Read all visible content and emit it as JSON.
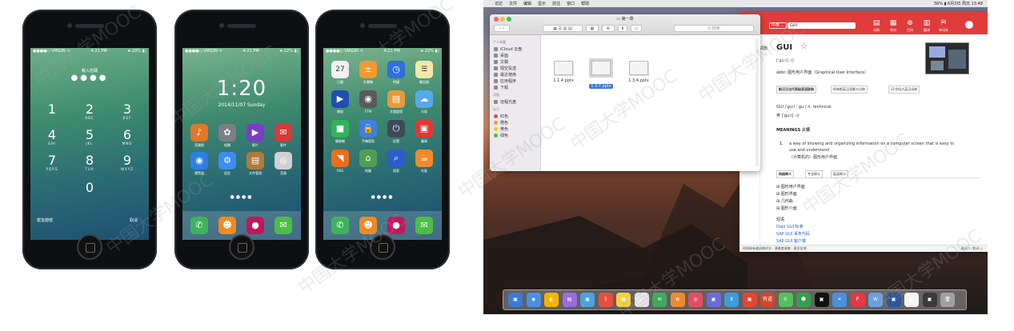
{
  "phones": [
    {
      "status": {
        "carrier": "●●●●○ VIRGIN ᯤ",
        "time": "4:21 PM",
        "battery": "⎈ 20% ▮▯"
      },
      "title": "輸入密碼",
      "keys": [
        {
          "n": "1",
          "l": ""
        },
        {
          "n": "2",
          "l": "ABC"
        },
        {
          "n": "3",
          "l": "DEF"
        },
        {
          "n": "4",
          "l": "GHI"
        },
        {
          "n": "5",
          "l": "JKL"
        },
        {
          "n": "6",
          "l": "MNO"
        },
        {
          "n": "7",
          "l": "PQRS"
        },
        {
          "n": "8",
          "l": "TUV"
        },
        {
          "n": "9",
          "l": "WXYZ"
        },
        {
          "n": "0",
          "l": ""
        }
      ],
      "bottom_left": "緊急撥號",
      "bottom_right": "取消"
    },
    {
      "status": {
        "carrier": "●●●●○ VIRGIN ᯤ",
        "time": "4:21 PM",
        "battery": "⎈ 22% ▮▯"
      },
      "clock": "1:20",
      "date": "2014/11/07 Sunday",
      "apps": [
        {
          "label": "音樂館",
          "color": "#e2762b",
          "glyph": "♪"
        },
        {
          "label": "相簿",
          "color": "#7b7f86",
          "glyph": "✿"
        },
        {
          "label": "影片",
          "color": "#7a3cc4",
          "glyph": "▶"
        },
        {
          "label": "郵件",
          "color": "#d8393a",
          "glyph": "✉"
        },
        {
          "label": "瀏覽器",
          "color": "#2d7fe6",
          "glyph": "◉"
        },
        {
          "label": "設定",
          "color": "#3d8cf0",
          "glyph": "⚙"
        },
        {
          "label": "文件管理",
          "color": "#b07a3a",
          "glyph": "▤"
        },
        {
          "label": "音樂",
          "color": "#d0d0d0",
          "glyph": "◎"
        }
      ],
      "dock": [
        {
          "color": "#3fb35a",
          "glyph": "✆"
        },
        {
          "color": "#f08a1f",
          "glyph": "☻"
        },
        {
          "color": "#c2185b",
          "glyph": "●"
        },
        {
          "color": "#4cbf44",
          "glyph": "✉"
        }
      ]
    },
    {
      "status": {
        "carrier": "●●●●○ VIRGIN ᯤ",
        "time": "4:21 PM",
        "battery": "⎈ 22% ▮▯"
      },
      "apps": [
        {
          "label": "日曆",
          "color": "#f2f2f2",
          "glyph": "27",
          "dark": true
        },
        {
          "label": "計算機",
          "color": "#f39a2a",
          "glyph": "±"
        },
        {
          "label": "時鐘",
          "color": "#2f6fdc",
          "glyph": "◷"
        },
        {
          "label": "備忘錄",
          "color": "#f5e7a8",
          "glyph": "☰",
          "dark": true
        },
        {
          "label": "播放",
          "color": "#1f4fb0",
          "glyph": "▶"
        },
        {
          "label": "FTM",
          "color": "#5a5a5a",
          "glyph": "◉"
        },
        {
          "label": "文檔管理",
          "color": "#e79a3a",
          "glyph": "▤"
        },
        {
          "label": "天氣",
          "color": "#56a8ea",
          "glyph": "☁"
        },
        {
          "label": "攝像機",
          "color": "#2fb555",
          "glyph": "■"
        },
        {
          "label": "手機管家",
          "color": "#3e7fe0",
          "glyph": "🔒"
        },
        {
          "label": "設置",
          "color": "#3d4a58",
          "glyph": "⏻"
        },
        {
          "label": "圖庫",
          "color": "#e33838",
          "glyph": "▣"
        },
        {
          "label": "RSS",
          "color": "#f26a1b",
          "glyph": "◥"
        },
        {
          "label": "地圖",
          "color": "#4f9e52",
          "glyph": "⌂"
        },
        {
          "label": "搜索",
          "color": "#2a5fc8",
          "glyph": "⌕"
        },
        {
          "label": "社區",
          "color": "#f28a2a",
          "glyph": "☕"
        }
      ],
      "dock": [
        {
          "color": "#3fb35a",
          "glyph": "✆"
        },
        {
          "color": "#f08a1f",
          "glyph": "☻"
        },
        {
          "color": "#c2185b",
          "glyph": "●"
        },
        {
          "color": "#4cbf44",
          "glyph": "✉"
        }
      ]
    }
  ],
  "mac": {
    "menubar": {
      "apple": "",
      "items": [
        "访达",
        "文件",
        "编辑",
        "显示",
        "前往",
        "窗口",
        "帮助"
      ],
      "right": "56% ▮ 6月3日 周日 13:48"
    },
    "finder": {
      "title": "第一章",
      "search_placeholder": "Q 搜索",
      "sidebar": {
        "section_personal": "个人收藏",
        "items": [
          "iCloud 云盘",
          "桌面",
          "文稿",
          "隔空投送",
          "最近使用",
          "应用程序",
          "下载"
        ],
        "section_devices": "设备",
        "devices": [
          "远程光盘"
        ],
        "section_tags": "标记",
        "tags": [
          {
            "label": "红色",
            "color": "#e24a4a"
          },
          {
            "label": "橙色",
            "color": "#f29a2a"
          },
          {
            "label": "黄色",
            "color": "#e8c72f"
          },
          {
            "label": "绿色",
            "color": "#46b44a"
          }
        ]
      },
      "files": [
        {
          "name": "1.1.4.pptx",
          "selected": false
        },
        {
          "name": "1.3.7.pptx",
          "selected": true
        },
        {
          "name": "1.3.4.pptx",
          "selected": false
        }
      ]
    },
    "dict": {
      "lang": "中英 ⌄",
      "query": "GUI",
      "tabs": [
        {
          "t": "词典",
          "g": "▤"
        },
        {
          "t": "例句",
          "g": "▦"
        },
        {
          "t": "百科",
          "g": "⊕"
        },
        {
          "t": "翻译",
          "g": "▥"
        },
        {
          "t": "单词本",
          "g": "⛿"
        }
      ],
      "left_menu": [
        "典词典",
        "义",
        "句",
        "科"
      ],
      "word": "GUI",
      "star": "☆",
      "phonetic": "[ˈɡuːi] ◁)",
      "abbr": "abbr. 图形用户界面（Graphical User Interface）",
      "source_tags": [
        "新汉汉当代高级英语辞典",
        "柯林斯英汉双解大词典",
        "21世纪大英汉词典"
      ],
      "pron": "GUI /ˈɡuːi ; ɡuː/    n.    technical",
      "pron2": "英 [ˈɡuːi] ◁)",
      "meanings_title": "MEANINGS 义项",
      "meaning_num": "1.",
      "meaning_en1": "a way of showing and organizing information on a computer screen that is easy to",
      "meaning_en2": "use and understand",
      "meaning_zh": "（计算机的）图形用户界面",
      "net_tabs": [
        "网络释义",
        "专业释义",
        "英英释义"
      ],
      "net_items": [
        "图形用户界面",
        "图形界面",
        "几何曲",
        "图形介面"
      ],
      "phrase_title": "短语",
      "phrases": [
        "Dojo GUI  标准",
        "SAP GUI  事务代码",
        "SAP GUI  客户端"
      ],
      "footer": "给网易有道词典评分 · 满意度调查 · 意见反馈",
      "footer_right": "取词 ☐  划词 ☐"
    },
    "dock_colors": [
      "#3a7bd5",
      "#4a90e2",
      "#f4b400",
      "#9b6be0",
      "#4aa3df",
      "#e94e3c",
      "#f5d142",
      "#e8e8e8",
      "#3faa5a",
      "#f08a2a",
      "#e04f5f",
      "#6c6cd8",
      "#3b9ddd",
      "#e8452f",
      "#d6442b",
      "#52c15a",
      "#31a24c",
      "#111111",
      "#4a8fe0",
      "#e63946",
      "#6aa0e0",
      "#2b5797",
      "#f5f5f5",
      "#3a3a3a",
      "#a0a0a0"
    ],
    "dock_labels": [
      "▣",
      "◉",
      "◐",
      "▤",
      "▣",
      "3",
      "▦",
      "▤",
      "✉",
      "✿",
      "◎",
      "▣",
      "⬆",
      "▣",
      "有道",
      "✆",
      "☻",
      "▣",
      "✕",
      "P",
      "W",
      "▣",
      "▣",
      "▣",
      "🗑"
    ]
  },
  "watermark": "中国大学MOOC"
}
